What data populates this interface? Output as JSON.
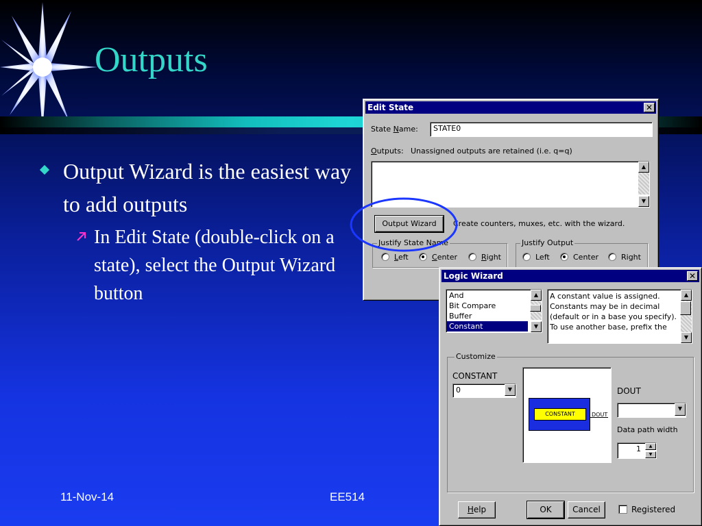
{
  "slide": {
    "title": "Outputs",
    "bullet_1": "Output Wizard is the easiest way to add outputs",
    "bullet_2": "In Edit State (double-click on a state), select the Output Wizard button",
    "footer_date": "11-Nov-14",
    "footer_center": "EE514"
  },
  "colors": {
    "title": "#33d6c8",
    "highlight_ellipse": "#1a36ff",
    "bullet_marker": "#33d6c8",
    "sub_bullet_marker": "#ff33cc",
    "dialog_titlebar": "#000080"
  },
  "edit_state": {
    "title": "Edit State",
    "close_glyph": "✕",
    "state_name_label_pre": "State ",
    "state_name_label_key": "N",
    "state_name_label_post": "ame:",
    "state_name_value": "STATE0",
    "outputs_label_key": "O",
    "outputs_label_post": "utputs:",
    "outputs_note": "Unassigned outputs are retained (i.e. q=q)",
    "output_wizard_button": "Output Wizard",
    "output_wizard_note": "Create counters, muxes, etc. with the wizard.",
    "justify_state_name": {
      "label": "Justify State Name",
      "options": [
        {
          "key": "L",
          "rest": "eft",
          "selected": false
        },
        {
          "key": "C",
          "rest": "enter",
          "selected": true
        },
        {
          "key": "R",
          "rest": "ight",
          "selected": false
        }
      ]
    },
    "justify_output": {
      "label": "Justify Output",
      "options": [
        {
          "label": "Left",
          "selected": false
        },
        {
          "label": "Center",
          "selected": true
        },
        {
          "label": "Right",
          "selected": false
        }
      ]
    }
  },
  "logic_wizard": {
    "title": "Logic Wizard",
    "close_glyph": "✕",
    "list_items": [
      "And",
      "Bit Compare",
      "Buffer",
      "Constant"
    ],
    "selected_item": "Constant",
    "description": "A constant value is assigned. Constants may be in decimal (default or in a base you specify). To use another base, prefix the",
    "customize_label": "Customize",
    "constant_label": "CONSTANT",
    "constant_value": "0",
    "preview_block": "CONSTANT",
    "preview_output": "DOUT",
    "dout_label": "DOUT",
    "dout_value": "",
    "data_path_label": "Data path width",
    "data_path_value": "1",
    "help_button_key": "H",
    "help_button_rest": "elp",
    "ok_button": "OK",
    "cancel_button": "Cancel",
    "registered_label": "Registered",
    "registered_checked": false
  }
}
